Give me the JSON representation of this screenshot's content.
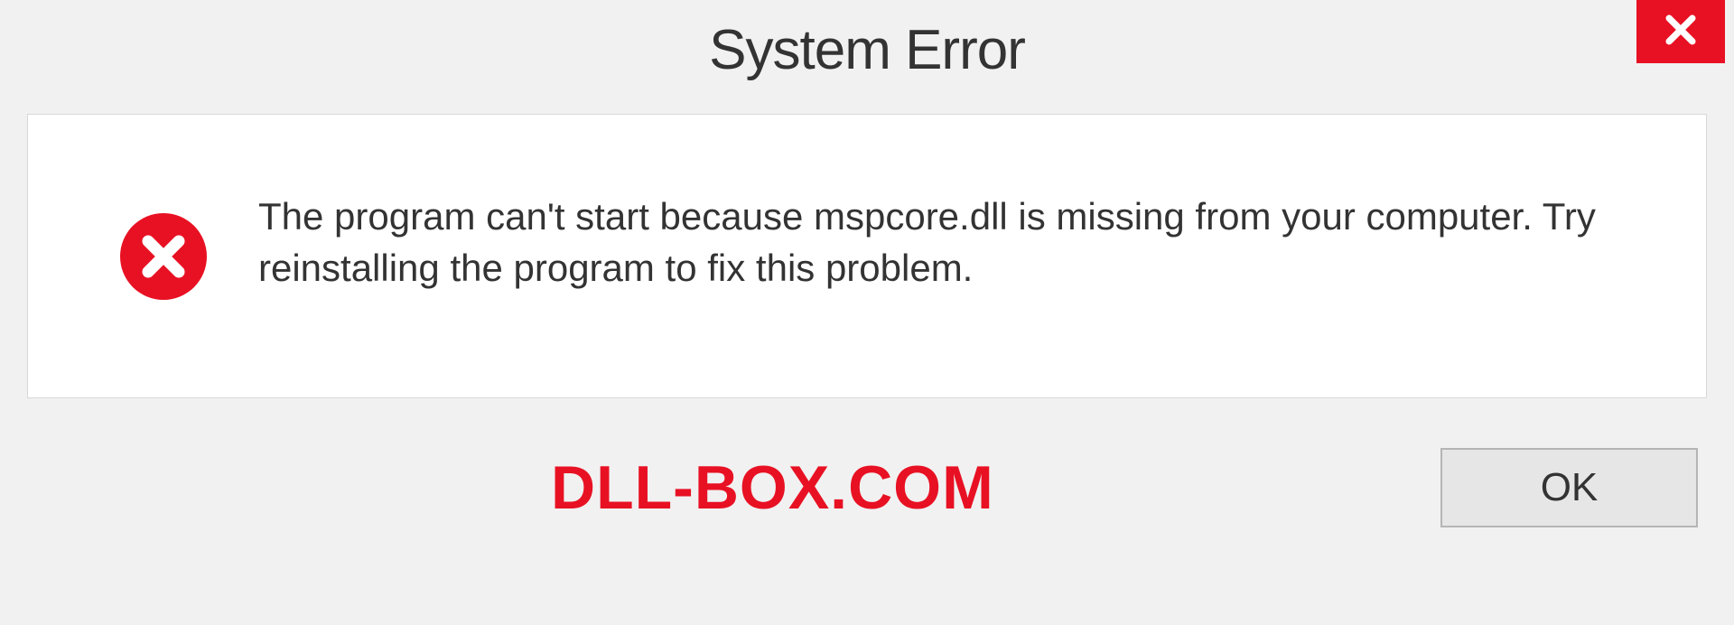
{
  "dialog": {
    "title": "System Error",
    "message": "The program can't start because mspcore.dll is missing from your computer. Try reinstalling the program to fix this problem.",
    "ok_label": "OK"
  },
  "watermark": "DLL-BOX.COM"
}
